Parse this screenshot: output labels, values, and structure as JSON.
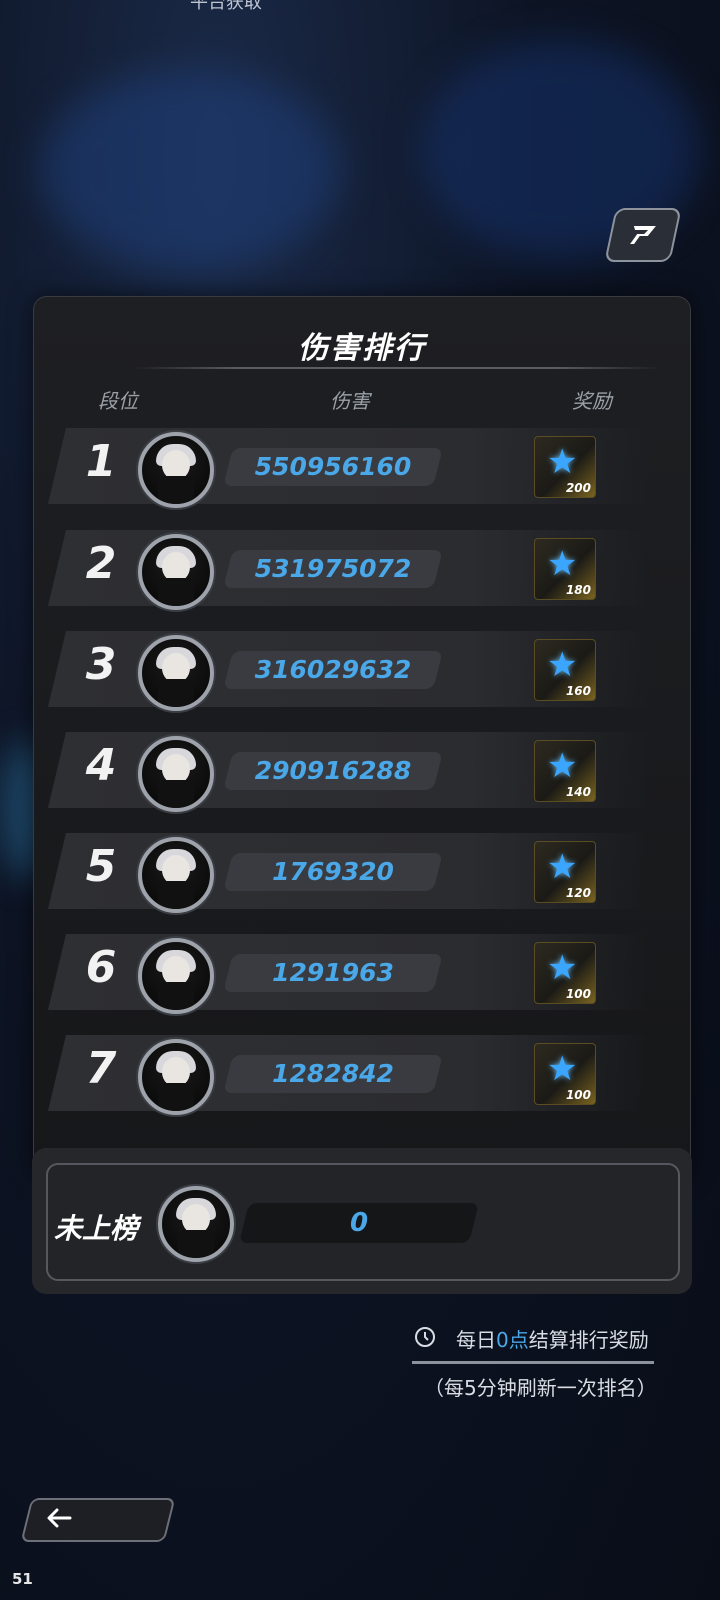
{
  "top_partial_text": "平台获取",
  "panel": {
    "title": "伤害排行",
    "headers": {
      "rank": "段位",
      "damage": "伤害",
      "reward": "奖励"
    },
    "rows": [
      {
        "rank": "1",
        "damage": "550956160",
        "reward": "200"
      },
      {
        "rank": "2",
        "damage": "531975072",
        "reward": "180"
      },
      {
        "rank": "3",
        "damage": "316029632",
        "reward": "160"
      },
      {
        "rank": "4",
        "damage": "290916288",
        "reward": "140"
      },
      {
        "rank": "5",
        "damage": "1769320",
        "reward": "120"
      },
      {
        "rank": "6",
        "damage": "1291963",
        "reward": "100"
      },
      {
        "rank": "7",
        "damage": "1282842",
        "reward": "100"
      }
    ]
  },
  "me": {
    "label": "未上榜",
    "damage": "0"
  },
  "info": {
    "prefix": "每日",
    "highlight": "0点",
    "suffix": "结算排行奖励",
    "refresh": "（每5分钟刷新一次排名）"
  },
  "fps": "51",
  "colors": {
    "accent": "#4aa8e8",
    "panel": "#1b1c1f",
    "star": "#3ba6ff"
  },
  "icons": {
    "corner": "share-icon",
    "clock": "clock-icon",
    "back": "arrow-left-icon",
    "reward": "star-icon"
  }
}
